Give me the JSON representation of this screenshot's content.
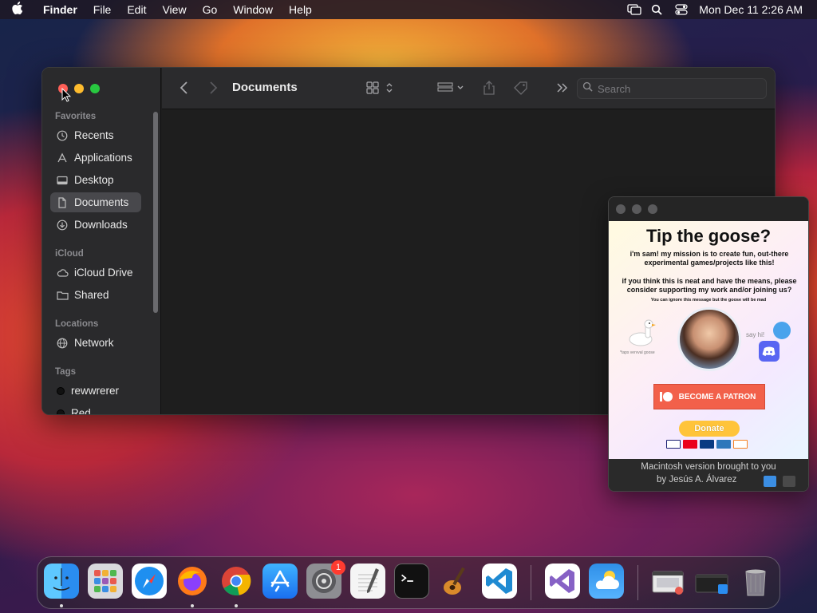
{
  "menubar": {
    "app": "Finder",
    "items": [
      "File",
      "Edit",
      "View",
      "Go",
      "Window",
      "Help"
    ],
    "clock": "Mon Dec 11  2:26 AM"
  },
  "finder": {
    "title": "Documents",
    "search_placeholder": "Search",
    "sidebar": {
      "favorites_header": "Favorites",
      "favorites": [
        {
          "label": "Recents",
          "icon": "clock-icon"
        },
        {
          "label": "Applications",
          "icon": "applications-icon"
        },
        {
          "label": "Desktop",
          "icon": "desktop-icon"
        },
        {
          "label": "Documents",
          "icon": "document-icon"
        },
        {
          "label": "Downloads",
          "icon": "download-icon"
        }
      ],
      "icloud_header": "iCloud",
      "icloud": [
        {
          "label": "iCloud Drive",
          "icon": "cloud-icon"
        },
        {
          "label": "Shared",
          "icon": "shared-folder-icon"
        }
      ],
      "locations_header": "Locations",
      "locations": [
        {
          "label": "Network",
          "icon": "globe-icon"
        }
      ],
      "tags_header": "Tags",
      "tags": [
        {
          "label": "rewwrerer",
          "color": "#111111"
        },
        {
          "label": "Red",
          "color": "#111111"
        }
      ]
    }
  },
  "goose": {
    "title": "Tip the goose?",
    "p1": "i'm sam! my mission is to create fun, out-there experimental games/projects like this!",
    "p2": "if you think this is neat and have the means, please consider supporting my work and/or joining us?",
    "small": "You can ignore this message but the goose will be mad",
    "goose_note": "*taps vervval goose",
    "say_hi": "say hi!",
    "patron_label": "BECOME A PATRON",
    "donate_label": "Donate",
    "footer_line1": "Macintosh version brought to you",
    "footer_line2": "by Jesús A. Álvarez"
  },
  "dock": {
    "apps": [
      "Finder",
      "Launchpad",
      "Safari",
      "Firefox",
      "Chrome",
      "App Store",
      "System Settings",
      "TextEdit",
      "Terminal",
      "GarageBand",
      "Visual Studio Code",
      "Visual Studio",
      "Weather",
      "Window Preview",
      "Finder Windows",
      "Trash"
    ],
    "settings_badge": "1"
  },
  "colors": {
    "accent_red": "#ff5f57",
    "accent_yellow": "#febc2e",
    "accent_green": "#28c840",
    "patron": "#f2604a",
    "donate": "#ffc43a"
  }
}
